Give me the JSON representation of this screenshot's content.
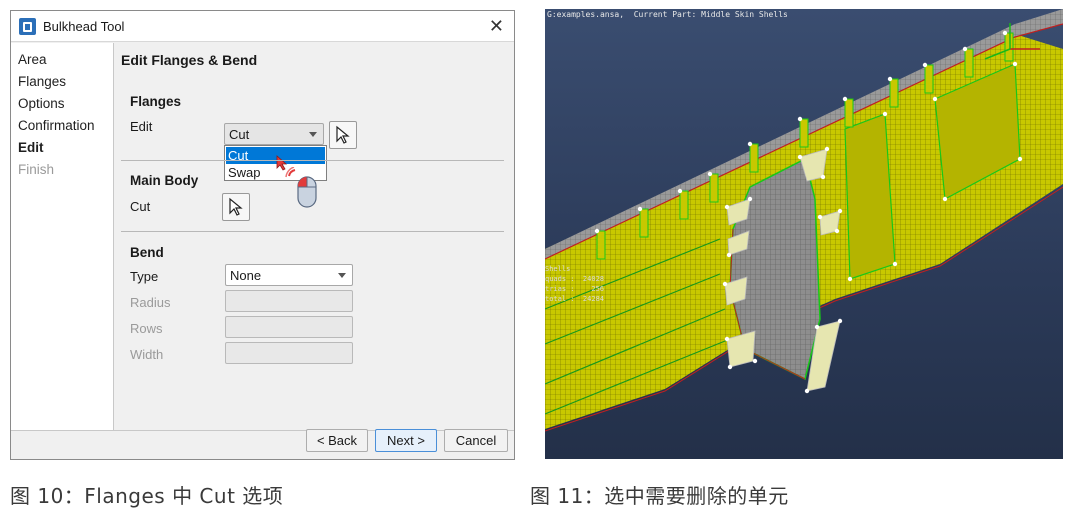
{
  "dialog": {
    "title": "Bulkhead Tool",
    "close_glyph": "✕",
    "sidebar": {
      "items": [
        {
          "label": "Area",
          "state": "normal"
        },
        {
          "label": "Flanges",
          "state": "normal"
        },
        {
          "label": "Options",
          "state": "normal"
        },
        {
          "label": "Confirmation",
          "state": "normal"
        },
        {
          "label": "Edit",
          "state": "active"
        },
        {
          "label": "Finish",
          "state": "disabled"
        }
      ]
    },
    "content": {
      "title": "Edit Flanges & Bend",
      "flanges": {
        "heading": "Flanges",
        "edit_label": "Edit",
        "edit_value": "Cut",
        "dropdown_options": [
          "Cut",
          "Swap"
        ],
        "selected_option": "Cut"
      },
      "main_body": {
        "heading": "Main Body",
        "cut_label": "Cut"
      },
      "bend": {
        "heading": "Bend",
        "type_label": "Type",
        "type_value": "None",
        "radius_label": "Radius",
        "rows_label": "Rows",
        "width_label": "Width"
      }
    },
    "footer": {
      "back_label": "< Back",
      "next_label": "Next >",
      "cancel_label": "Cancel"
    }
  },
  "viewport": {
    "header_text": "G:examples.ansa,  Current Part: Middle Skin Shells",
    "stats": [
      "Shells",
      "quads :  24028",
      "trias :    256",
      "total :  24284"
    ],
    "colors": {
      "mesh": "#c8c800",
      "flange": "#e0e0a8",
      "body": "#8e8e8e",
      "edge": "#c02020",
      "seam": "#18c818"
    }
  },
  "captions": {
    "left": "图 10：Flanges 中 Cut 选项",
    "right": "图 11：选中需要删除的单元"
  },
  "colors": {
    "accent": "#0078d7",
    "app_icon": "#2b6fb8"
  }
}
